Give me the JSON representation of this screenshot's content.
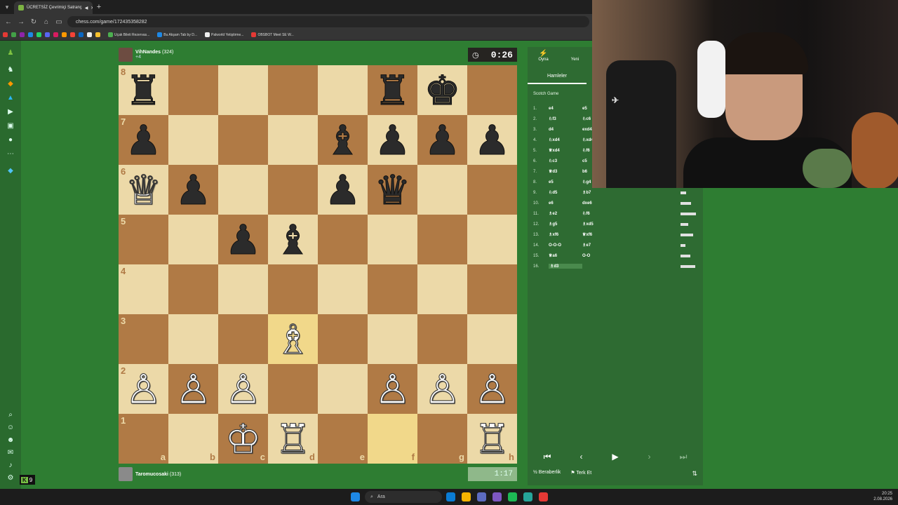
{
  "browser": {
    "tab_title": "ÜCRETSİZ Çevrimiçi Satranç",
    "url": "chess.com/game/172435358282",
    "bookmarks": [
      "Uçak Bileti Rezervas...",
      "Bu Akşam Tab by D...",
      "Palworld Yetiştirme...",
      "OBSBOT Meet SE W..."
    ]
  },
  "top_player": {
    "name": "VihNandes",
    "rating": "(324)",
    "clock": "0:26",
    "material": "+4"
  },
  "bottom_player": {
    "name": "Taromucosaki",
    "rating": "(313)",
    "clock": "1:17"
  },
  "board": {
    "files": [
      "a",
      "b",
      "c",
      "d",
      "e",
      "f",
      "g",
      "h"
    ],
    "ranks": [
      "8",
      "7",
      "6",
      "5",
      "4",
      "3",
      "2",
      "1"
    ],
    "rows": [
      [
        "bR",
        "",
        "",
        "",
        "",
        "bR",
        "bK",
        ""
      ],
      [
        "bP",
        "",
        "",
        "",
        "bB",
        "bP",
        "bP",
        "bP"
      ],
      [
        "wQ",
        "bP",
        "",
        "",
        "bP",
        "bQ",
        "",
        ""
      ],
      [
        "",
        "",
        "bP",
        "bB",
        "",
        "",
        "",
        ""
      ],
      [
        "",
        "",
        "",
        "",
        "",
        "",
        "",
        ""
      ],
      [
        "",
        "",
        "",
        "wB",
        "",
        "",
        "",
        ""
      ],
      [
        "wP",
        "wP",
        "wP",
        "",
        "",
        "wP",
        "wP",
        "wP"
      ],
      [
        "",
        "",
        "wK",
        "wR",
        "",
        "",
        "",
        "wR"
      ]
    ],
    "highlights": [
      "d3",
      "f1"
    ]
  },
  "panel": {
    "tab_play": "Oyna",
    "tab_new": "Yeni",
    "subtab": "Hamleler",
    "opening": "Scotch Game",
    "moves": [
      {
        "n": "1.",
        "w": "e4",
        "b": "e5"
      },
      {
        "n": "2.",
        "w": "♘f3",
        "b": "♘c6"
      },
      {
        "n": "3.",
        "w": "d4",
        "b": "exd4"
      },
      {
        "n": "4.",
        "w": "♘xd4",
        "b": "♘xd4"
      },
      {
        "n": "5.",
        "w": "♕xd4",
        "b": "♘f6"
      },
      {
        "n": "6.",
        "w": "♘c3",
        "b": "c5"
      },
      {
        "n": "7.",
        "w": "♕d3",
        "b": "b6"
      },
      {
        "n": "8.",
        "w": "e5",
        "b": "♘g4"
      },
      {
        "n": "9.",
        "w": "♘d5",
        "b": "♗b7"
      },
      {
        "n": "10.",
        "w": "e6",
        "b": "dxe6"
      },
      {
        "n": "11.",
        "w": "♗e2",
        "b": "♘f6"
      },
      {
        "n": "12.",
        "w": "♗g5",
        "b": "♗xd5"
      },
      {
        "n": "13.",
        "w": "♗xf6",
        "b": "♕xf6"
      },
      {
        "n": "14.",
        "w": "O-O-O",
        "b": "♗e7"
      },
      {
        "n": "15.",
        "w": "♕a6",
        "b": "O-O"
      },
      {
        "n": "16.",
        "w": "♗d3",
        "b": ""
      }
    ],
    "footer_draw": "Beraberlik",
    "footer_resign": "Terk Et"
  },
  "taskbar": {
    "search_label": "Ara",
    "time": "20:25",
    "date": "2.08.2026"
  },
  "sidebar": {
    "badge": "9"
  },
  "colors": {
    "page_bg": "#2e7d32",
    "light_square": "#ecd9a8",
    "dark_square": "#b07a45",
    "highlight": "#d8a83c"
  }
}
